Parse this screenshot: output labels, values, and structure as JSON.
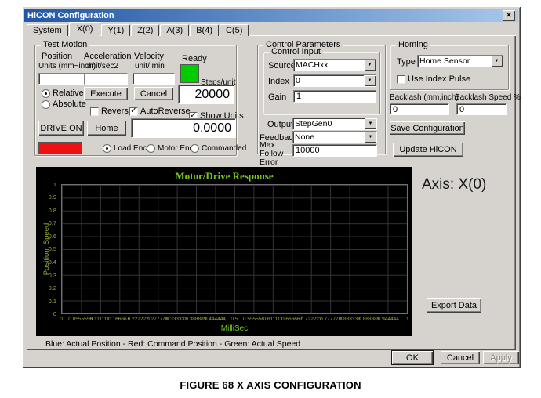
{
  "window": {
    "title": "HiCON Configuration"
  },
  "icons": {
    "close": "✕",
    "dropdown": "▼",
    "check": "✓"
  },
  "tabs": [
    "System",
    "X(0)",
    "Y(1)",
    "Z(2)",
    "A(3)",
    "B(4)",
    "C(5)"
  ],
  "test_motion": {
    "title": "Test Motion",
    "position_label": "Position",
    "position_units": "Units (mm~inch)",
    "position_value": "",
    "accel_label": "Acceleration",
    "accel_units": "unit/sec2",
    "accel_value": "",
    "velocity_label": "Velocity",
    "velocity_units": "unit/ min",
    "velocity_value": "",
    "ready_label": "Ready",
    "steps_per_unit_label": "Steps/unit",
    "steps_per_unit_value": "20000",
    "relative_label": "Relative",
    "absolute_label": "Absolute",
    "execute_button": "Execute",
    "cancel_button": "Cancel",
    "reverse_label": "Reverse",
    "autoreverse_label": "AutoReverse",
    "show_units_label": "Show Units",
    "drive_on_button": "DRIVE ON",
    "home_button": "Home",
    "position_display": "0.0000",
    "load_enc_label": "Load Enc",
    "motor_enc_label": "Motor Enc",
    "commanded_label": "Commanded"
  },
  "control_parameters": {
    "title": "Control Parameters",
    "control_input_title": "Control Input",
    "source_label": "Source",
    "source_value": "MACHxx",
    "index_label": "Index",
    "index_value": "0",
    "gain_label": "Gain",
    "gain_value": "1",
    "output_label": "Output",
    "output_value": "StepGen0",
    "feedback_label": "Feedback",
    "feedback_value": "None",
    "max_follow_error_label": "Max Follow Error",
    "max_follow_error_value": "10000"
  },
  "homing": {
    "title": "Homing",
    "type_label": "Type",
    "type_value": "Home Sensor",
    "use_index_pulse_label": "Use Index Pulse",
    "backlash_label": "Backlash (mm,inch)",
    "backlash_value": "0",
    "backlash_speed_label": "Backlash Speed %",
    "backlash_speed_value": "0",
    "save_configuration_button": "Save Configuration",
    "update_hicon_button": "Update HiCON"
  },
  "chart": {
    "title": "Motor/Drive Response",
    "ylabel": "Position, Speed",
    "xlabel": "MilliSec",
    "axis_label": "Axis: X(0)",
    "export_button": "Export Data",
    "legend": "Blue: Actual Position -  Red: Command Position - Green: Actual Speed",
    "y_ticks": [
      "1",
      "0.9",
      "0.8",
      "0.7",
      "0.6",
      "0.5",
      "0.4",
      "0.3",
      "0.2",
      "0.1",
      "0"
    ],
    "x_ticks": [
      "0",
      "0.0555556",
      "0.111111",
      "0.166667",
      "0.222222",
      "0.277778",
      "0.333333",
      "0.388889",
      "0.444444",
      "0.5",
      "0.555556",
      "0.611111",
      "0.666667",
      "0.722222",
      "0.777778",
      "0.833333",
      "0.888889",
      "0.944444",
      "1"
    ]
  },
  "footer": {
    "ok": "OK",
    "cancel": "Cancel",
    "apply": "Apply"
  },
  "caption": "FIGURE 68 X AXIS CONFIGURATION",
  "colors": {
    "ready_indicator": "#00cc00",
    "drive_indicator": "#ee1111",
    "chart_text": "#9aad3a",
    "chart_title": "#79c41c",
    "titlebar_start": "#2056a5",
    "titlebar_end": "#a8c8ec"
  }
}
